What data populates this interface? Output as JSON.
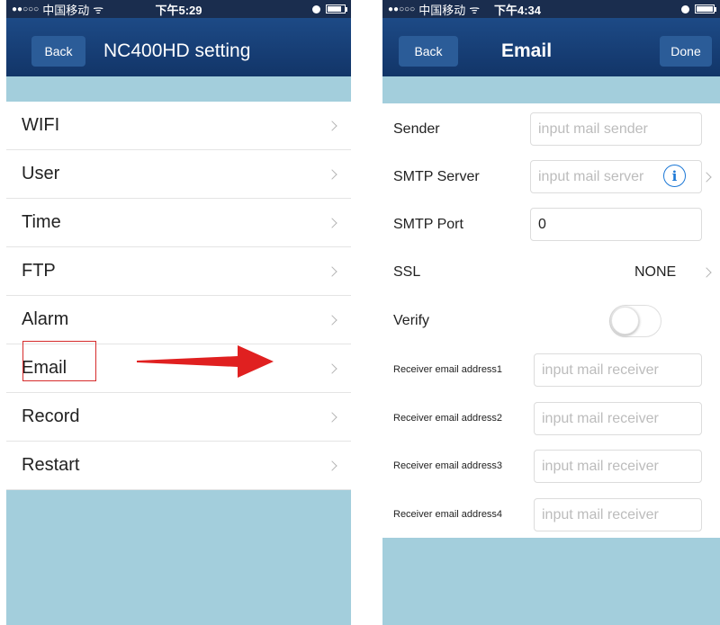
{
  "left_screen": {
    "status": {
      "dots": "●●○○○",
      "carrier": "中国移动",
      "wifi_glyph": "ᯤ",
      "time": "下午5:29",
      "battery_level": 0.75
    },
    "nav": {
      "back_label": "Back",
      "title": "NC400HD setting"
    },
    "menu": [
      {
        "label": "WIFI"
      },
      {
        "label": "User"
      },
      {
        "label": "Time"
      },
      {
        "label": "FTP"
      },
      {
        "label": "Alarm"
      },
      {
        "label": "Email"
      },
      {
        "label": "Record"
      },
      {
        "label": "Restart"
      }
    ],
    "highlighted_item": "Email",
    "annotation_arrow_color": "#e02020"
  },
  "right_screen": {
    "status": {
      "dots": "●●○○○",
      "carrier": "中国移动",
      "wifi_glyph": "ᯤ",
      "time": "下午4:34",
      "battery_level": 0.9
    },
    "nav": {
      "back_label": "Back",
      "title": "Email",
      "done_label": "Done"
    },
    "form": {
      "sender": {
        "label": "Sender",
        "placeholder": "input mail sender"
      },
      "smtp_server": {
        "label": "SMTP Server",
        "placeholder": "input mail server",
        "info_glyph": "i"
      },
      "smtp_port": {
        "label": "SMTP Port",
        "value": "0"
      },
      "ssl": {
        "label": "SSL",
        "value": "NONE"
      },
      "verify": {
        "label": "Verify",
        "enabled": false
      },
      "receivers": [
        {
          "label": "Receiver email address1",
          "placeholder": "input mail receiver"
        },
        {
          "label": "Receiver email address2",
          "placeholder": "input mail receiver"
        },
        {
          "label": "Receiver email address3",
          "placeholder": "input mail receiver"
        },
        {
          "label": "Receiver email address4",
          "placeholder": "input mail receiver"
        }
      ]
    }
  },
  "colors": {
    "navbar": "#1a417a",
    "statusbar": "#1a2d4e",
    "band": "#a3cedc",
    "info_blue": "#1c78d6"
  }
}
